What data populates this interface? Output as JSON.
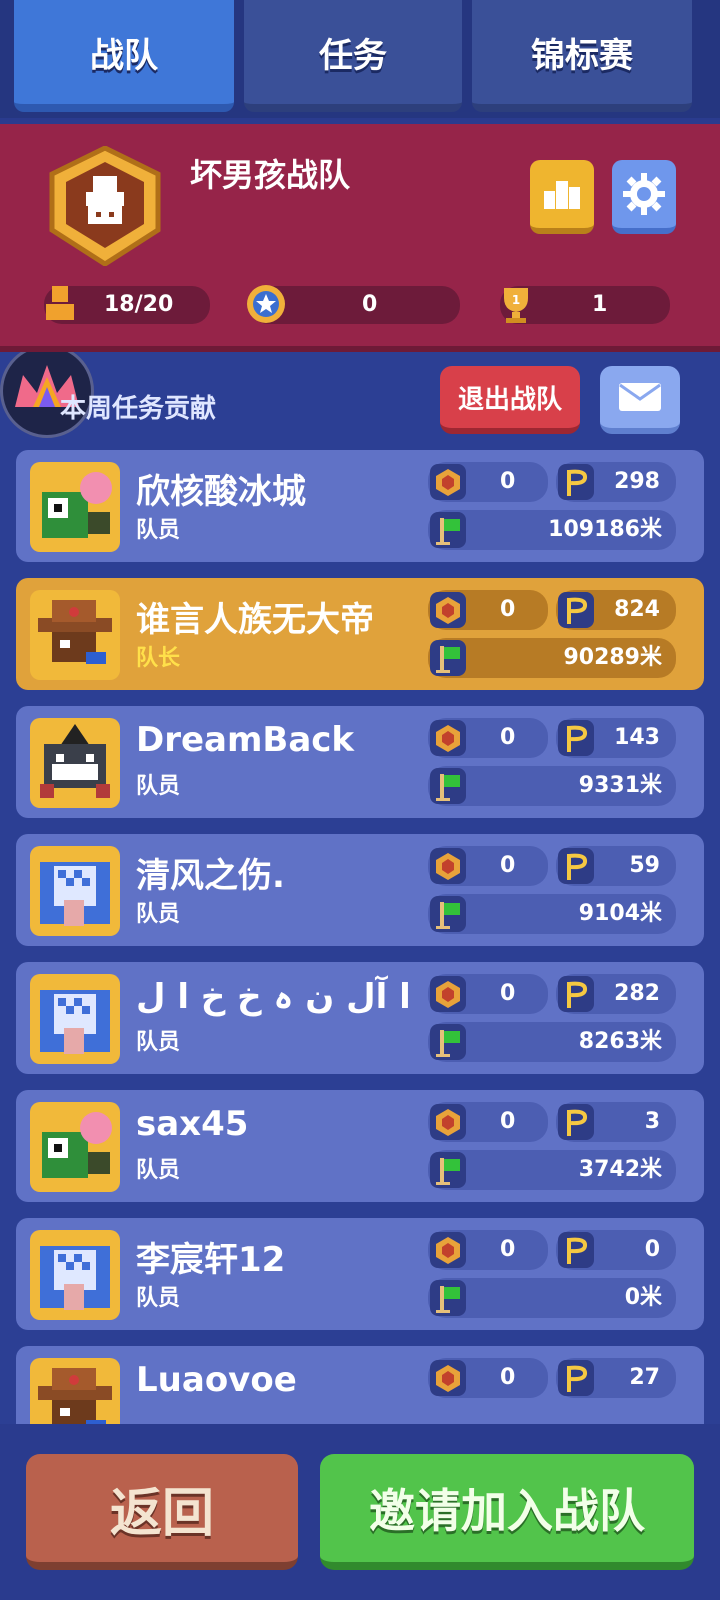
{
  "tabs": [
    {
      "label": "战队",
      "active": true
    },
    {
      "label": "任务",
      "active": false
    },
    {
      "label": "锦标赛",
      "active": false
    }
  ],
  "team": {
    "name": "坏男孩战队",
    "stats": {
      "members": "18/20",
      "stars": "0",
      "trophies": "1"
    }
  },
  "weekly_label": "本周任务贡献",
  "quit_label": "退出战队",
  "members": [
    {
      "name": "欣核酸冰城",
      "role": "队员",
      "medals": "0",
      "flags": "298",
      "distance": "109186米",
      "leader": false,
      "avatar": "green-robot"
    },
    {
      "name": "谁言人族无大帝",
      "role": "队长",
      "medals": "0",
      "flags": "824",
      "distance": "90289米",
      "leader": true,
      "avatar": "cowboy"
    },
    {
      "name": "DreamBack",
      "role": "队员",
      "medals": "0",
      "flags": "143",
      "distance": "9331米",
      "leader": false,
      "avatar": "shark"
    },
    {
      "name": "清风之伤.",
      "role": "队员",
      "medals": "0",
      "flags": "59",
      "distance": "9104米",
      "leader": false,
      "avatar": "elephant"
    },
    {
      "name": "ا آل ن ہ خ خ ا ل",
      "role": "队员",
      "medals": "0",
      "flags": "282",
      "distance": "8263米",
      "leader": false,
      "avatar": "elephant"
    },
    {
      "name": "sax45",
      "role": "队员",
      "medals": "0",
      "flags": "3",
      "distance": "3742米",
      "leader": false,
      "avatar": "green-robot"
    },
    {
      "name": "李宸轩12",
      "role": "队员",
      "medals": "0",
      "flags": "0",
      "distance": "0米",
      "leader": false,
      "avatar": "elephant"
    },
    {
      "name": "Luaovoe",
      "role": "",
      "medals": "0",
      "flags": "27",
      "distance": "",
      "leader": false,
      "avatar": "cowboy"
    }
  ],
  "bottom": {
    "back_label": "返回",
    "invite_label": "邀请加入战队"
  },
  "colors": {
    "team_header": "#962449",
    "card": "#6072c6",
    "leader_card": "#e0a23b",
    "back": "#b9614d",
    "invite": "#52c44b"
  }
}
